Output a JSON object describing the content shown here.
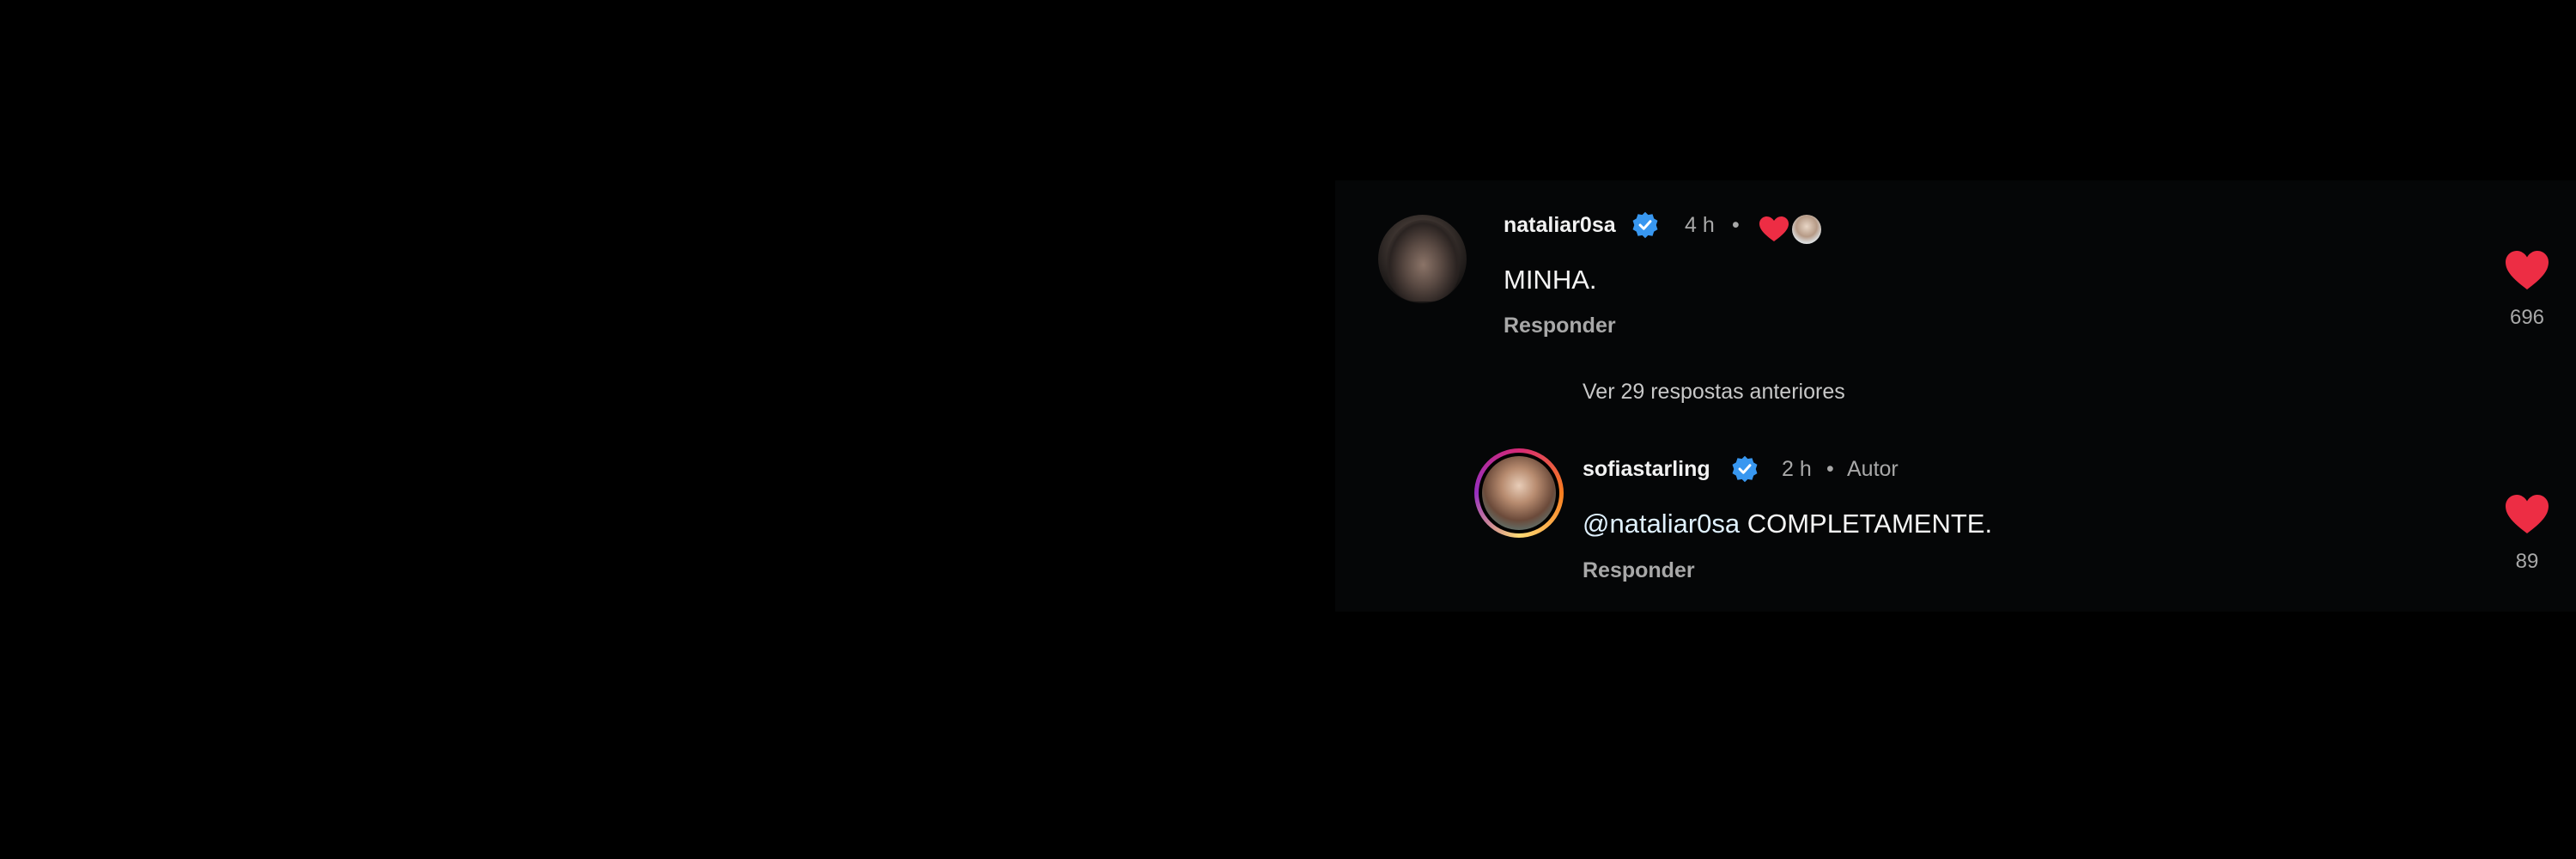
{
  "comment": {
    "username": "nataliar0sa",
    "time": "4 h",
    "separator": "•",
    "text": "MINHA.",
    "reply_label": "Responder",
    "likes": "696",
    "heart_color": "#ed2d44"
  },
  "view_replies": {
    "label": "Ver 29 respostas anteriores"
  },
  "reply": {
    "username": "sofiastarling",
    "time": "2 h",
    "separator": "•",
    "author_badge": "Autor",
    "mention": "@nataliar0sa",
    "text": " COMPLETAMENTE.",
    "reply_label": "Responder",
    "likes": "89"
  },
  "colors": {
    "background": "#000000",
    "verified": "#3897f0",
    "heart": "#ed2d44"
  }
}
